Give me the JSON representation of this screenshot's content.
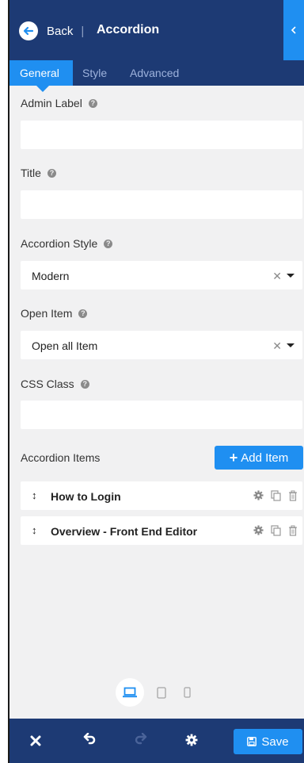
{
  "header": {
    "back_label": "Back",
    "separator": "|",
    "title": "Accordion"
  },
  "tabs": [
    {
      "label": "General",
      "active": true
    },
    {
      "label": "Style",
      "active": false
    },
    {
      "label": "Advanced",
      "active": false
    }
  ],
  "form": {
    "admin_label": {
      "label": "Admin Label",
      "value": ""
    },
    "title": {
      "label": "Title",
      "value": ""
    },
    "accordion_style": {
      "label": "Accordion Style",
      "value": "Modern"
    },
    "open_item": {
      "label": "Open Item",
      "value": "Open all Item"
    },
    "css_class": {
      "label": "CSS Class",
      "value": ""
    }
  },
  "items_section": {
    "label": "Accordion Items",
    "add_label": "Add Item",
    "items": [
      {
        "label": "How to Login"
      },
      {
        "label": "Overview - Front End Editor"
      }
    ]
  },
  "footer": {
    "save_label": "Save"
  },
  "colors": {
    "primary_dark": "#1d3a74",
    "accent": "#1f8ff1",
    "panel_bg": "#f1f1f2"
  }
}
